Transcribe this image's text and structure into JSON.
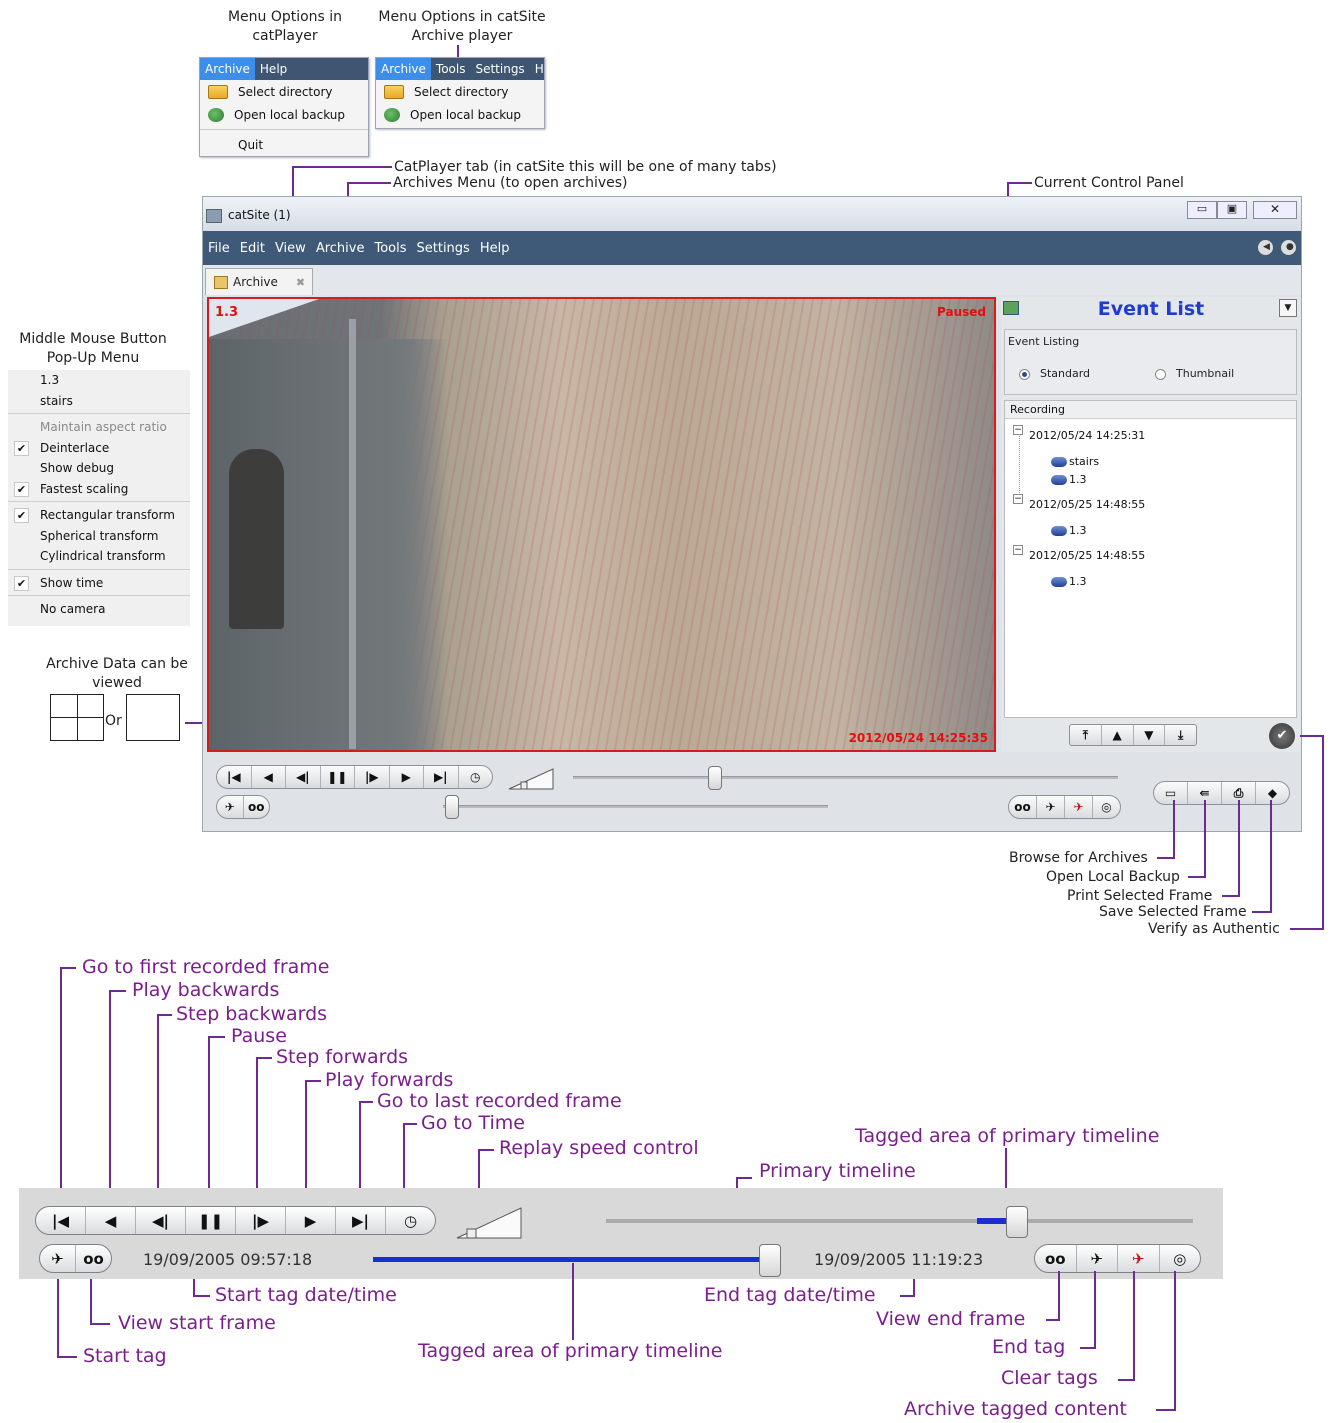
{
  "headings": {
    "catplayer_menu": "Menu Options in catPlayer",
    "catsite_menu": "Menu Options in catSite Archive player",
    "popup_menu": "Middle Mouse Button Pop-Up Menu",
    "archive_views": "Archive Data can be viewed",
    "or_label": "Or"
  },
  "catplayer_menu": {
    "bar": [
      "Archive",
      "Help"
    ],
    "items": [
      "Select directory",
      "Open local backup",
      "Quit"
    ]
  },
  "catsite_menu": {
    "bar": [
      "Archive",
      "Tools",
      "Settings",
      "H"
    ],
    "items": [
      "Select directory",
      "Open local backup"
    ]
  },
  "popup": {
    "items": [
      {
        "label": "1.3",
        "checked": false,
        "disabled": false
      },
      {
        "label": "stairs",
        "checked": false,
        "disabled": false
      },
      {
        "label": "Maintain aspect ratio",
        "checked": false,
        "disabled": true
      },
      {
        "label": "Deinterlace",
        "checked": true,
        "disabled": false
      },
      {
        "label": "Show debug",
        "checked": false,
        "disabled": false
      },
      {
        "label": "Fastest scaling",
        "checked": true,
        "disabled": false
      },
      {
        "label": "Rectangular transform",
        "checked": true,
        "disabled": false
      },
      {
        "label": "Spherical transform",
        "checked": false,
        "disabled": false
      },
      {
        "label": "Cylindrical transform",
        "checked": false,
        "disabled": false
      },
      {
        "label": "Show time",
        "checked": true,
        "disabled": false
      },
      {
        "label": "No camera",
        "checked": false,
        "disabled": false
      }
    ]
  },
  "window": {
    "title": "catSite (1)",
    "menu": [
      "File",
      "Edit",
      "View",
      "Archive",
      "Tools",
      "Settings",
      "Help"
    ],
    "tab_label": "Archive",
    "video": {
      "camera": "1.3",
      "status": "Paused",
      "timestamp": "2012/05/24 14:25:35"
    },
    "panel": {
      "title": "Event List",
      "event_listing_label": "Event Listing",
      "radio_standard": "Standard",
      "radio_thumbnail": "Thumbnail",
      "recording_label": "Recording",
      "groups": [
        {
          "date": "2012/05/24 14:25:31",
          "cams": [
            "stairs",
            "1.3"
          ]
        },
        {
          "date": "2012/05/25 14:48:55",
          "cams": [
            "1.3"
          ]
        },
        {
          "date": "2012/05/25 14:48:55",
          "cams": [
            "1.3"
          ]
        }
      ]
    },
    "timeline_position": 0.26
  },
  "annotations": {
    "catplayer_tab": "CatPlayer tab (in catSite this will be one of many tabs)",
    "archives_menu": "Archives Menu (to open archives)",
    "current_control_panel": "Current Control Panel",
    "browse": "Browse for Archives",
    "open_local": "Open Local Backup",
    "print": "Print Selected Frame",
    "save": "Save Selected Frame",
    "verify": "Verify as Authentic"
  },
  "detail": {
    "labels": {
      "first": "Go to first recorded frame",
      "play_back": "Play backwards",
      "step_back": "Step backwards",
      "pause": "Pause",
      "step_fwd": "Step forwards",
      "play_fwd": "Play forwards",
      "last": "Go to last recorded frame",
      "goto_time": "Go to Time",
      "speed": "Replay speed control",
      "tagged_primary_top": "Tagged area of primary timeline",
      "primary": "Primary timeline",
      "start_tag_dt": "Start tag date/time",
      "view_start": "View start frame",
      "start_tag": "Start tag",
      "tagged_primary_bottom": "Tagged area of primary timeline",
      "end_tag_dt": "End tag date/time",
      "view_end": "View end frame",
      "end_tag": "End tag",
      "clear_tags": "Clear tags",
      "archive_tagged": "Archive tagged content"
    },
    "start_date": "19/09/2005 09:57:18",
    "end_date": "19/09/2005 11:19:23",
    "primary_tag_level": 0.7
  },
  "colors": {
    "annotation": "#6d2a90",
    "window_menu": "#3f5a78",
    "highlight": "#3d8ee8",
    "video_border": "#d21d1d",
    "timeline": "#1a2fd1"
  }
}
